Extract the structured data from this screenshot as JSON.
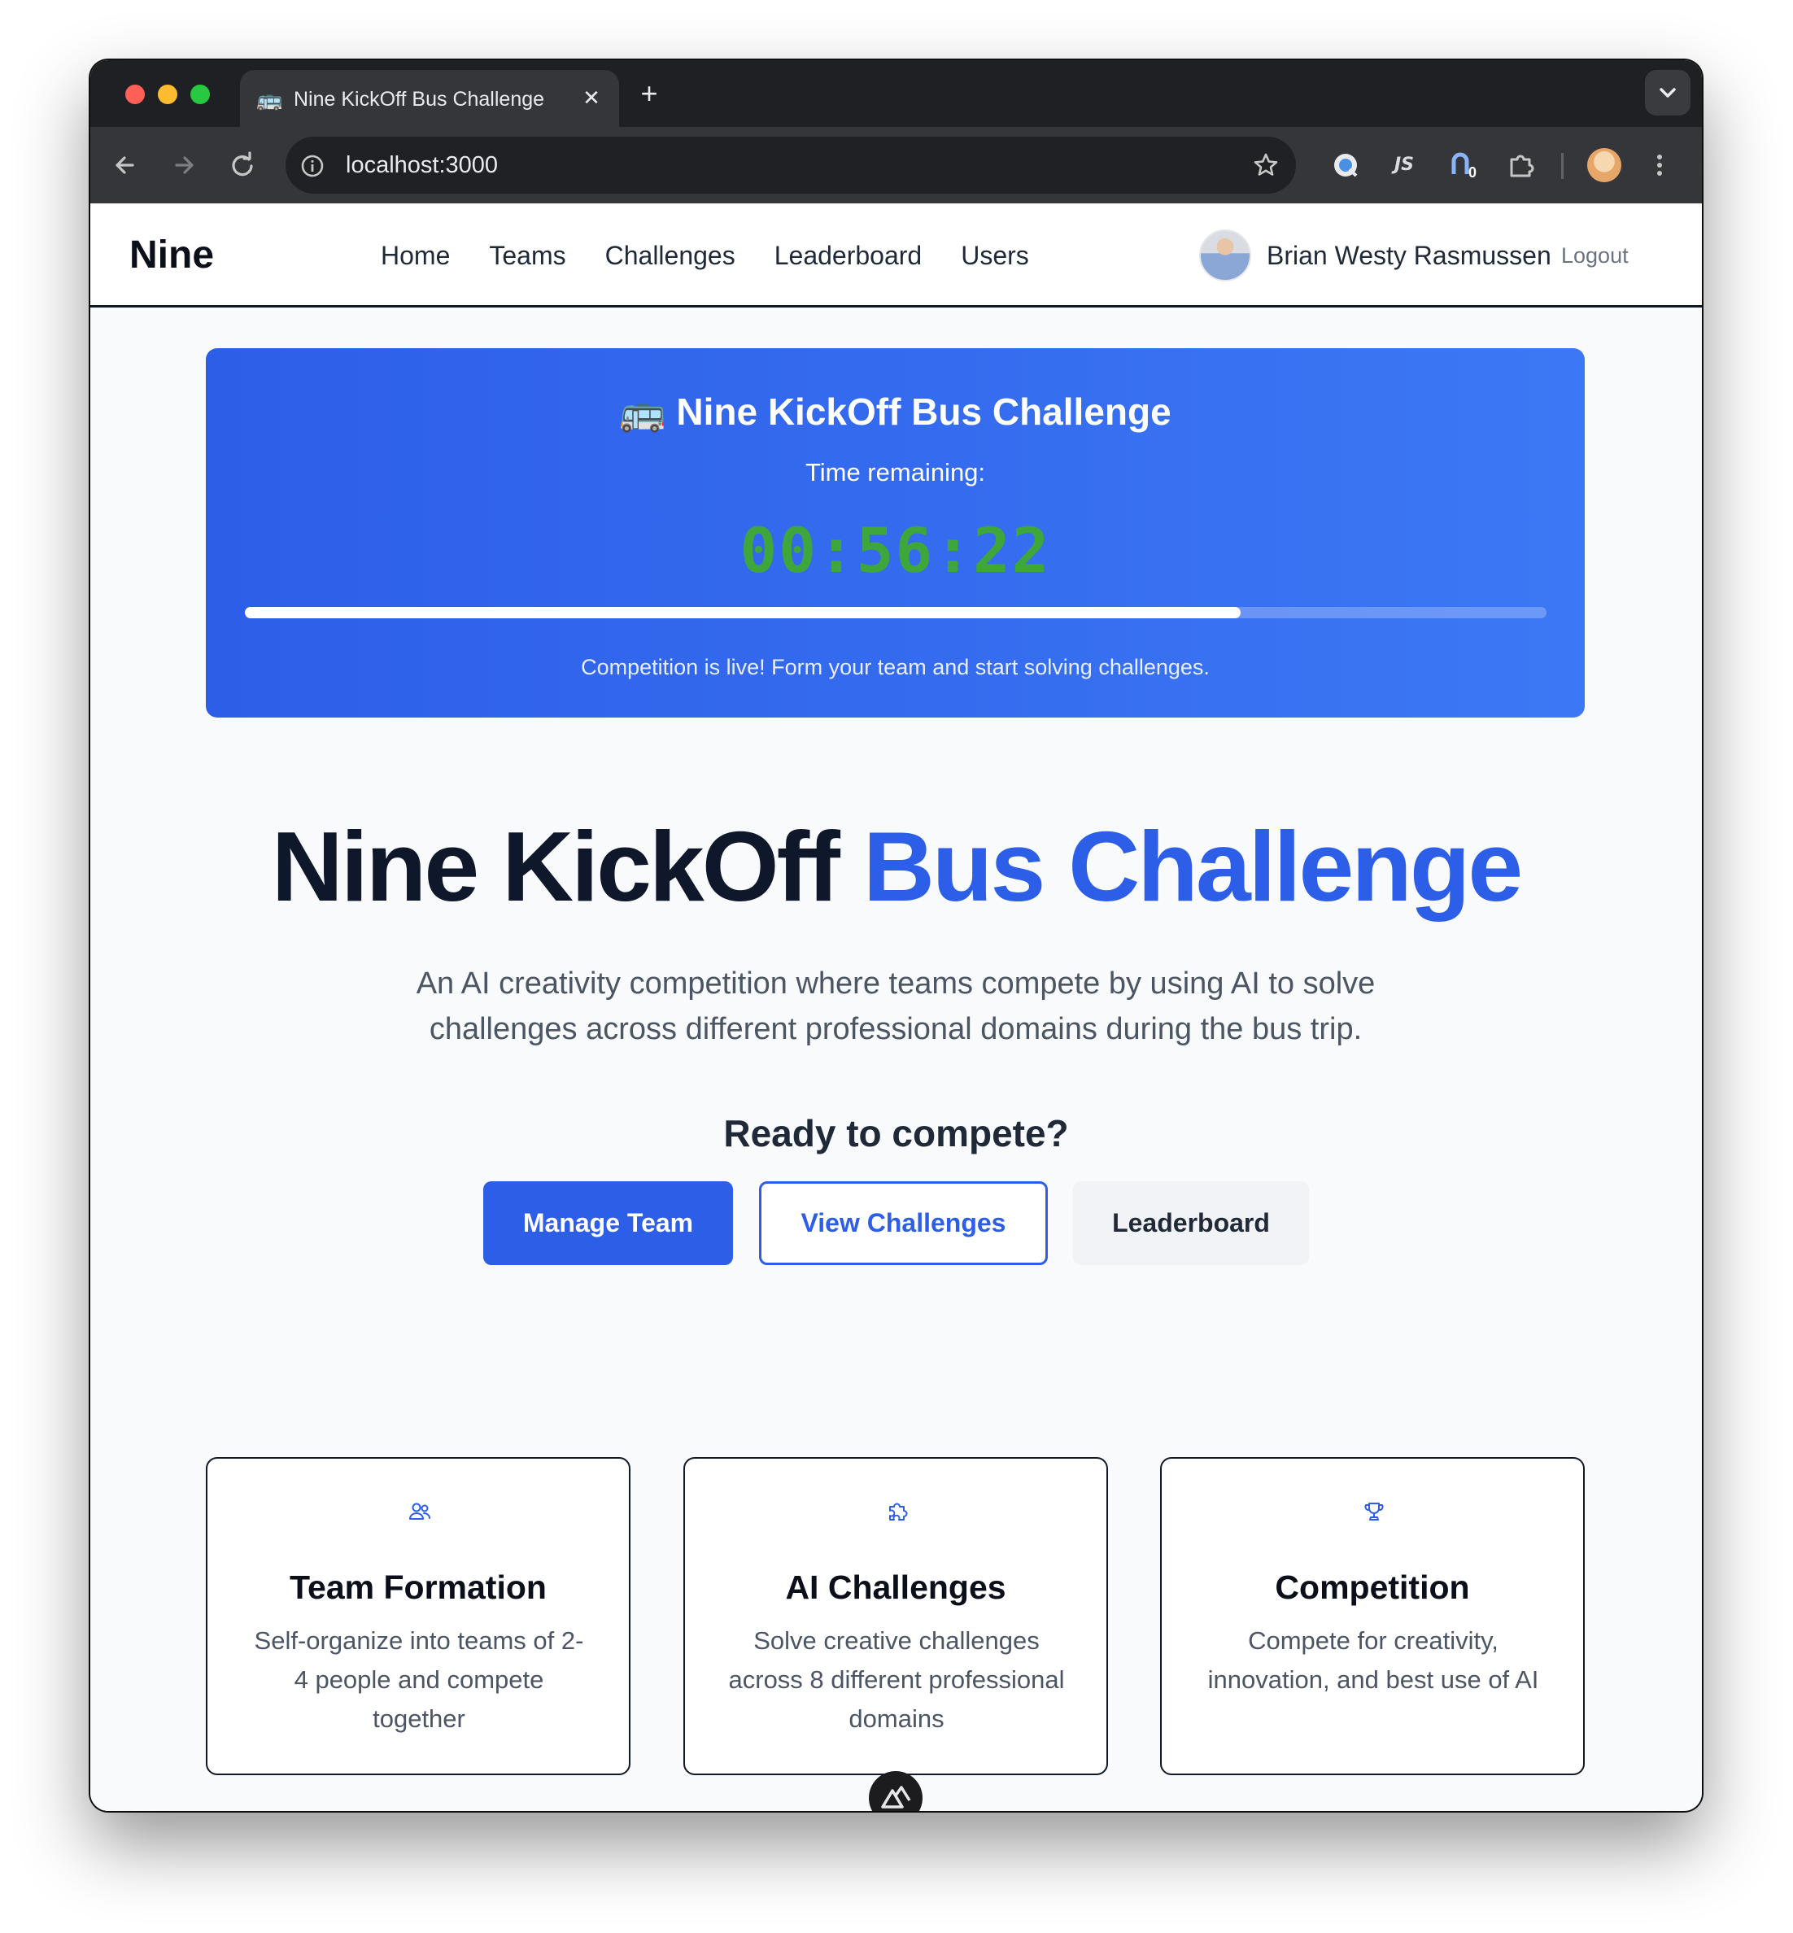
{
  "browser": {
    "tab_favicon": "🚌",
    "tab_title": "Nine KickOff Bus Challenge",
    "tab_close": "✕",
    "new_tab": "+",
    "url": "localhost:3000",
    "extensions": [
      {
        "name": "sparkle-extension-icon"
      },
      {
        "name": "js-extension-icon",
        "label": "JS"
      },
      {
        "name": "blue-extension-icon",
        "badge": "0"
      },
      {
        "name": "puzzle-extensions-icon"
      }
    ]
  },
  "header": {
    "brand": "Nine",
    "nav": [
      "Home",
      "Teams",
      "Challenges",
      "Leaderboard",
      "Users"
    ],
    "user_name": "Brian Westy Rasmussen",
    "logout": "Logout"
  },
  "countdown": {
    "icon": "🚌",
    "title": "Nine KickOff Bus Challenge",
    "subtitle": "Time remaining:",
    "timer": "00:56:22",
    "progress": 0.765,
    "note": "Competition is live! Form your team and start solving challenges."
  },
  "hero": {
    "title_main": "Nine KickOff ",
    "title_accent": "Bus Challenge",
    "lead": "An AI creativity competition where teams compete by using AI to solve challenges across different professional domains during the bus trip.",
    "cta_heading": "Ready to compete?",
    "buttons": {
      "manage_team": "Manage Team",
      "view_challenges": "View Challenges",
      "leaderboard": "Leaderboard"
    }
  },
  "features": [
    {
      "icon": "users-icon",
      "title": "Team Formation",
      "desc": "Self-organize into teams of 2-4 people and compete together"
    },
    {
      "icon": "puzzle-icon",
      "title": "AI Challenges",
      "desc": "Solve creative challenges across 8 different professional domains"
    },
    {
      "icon": "trophy-icon",
      "title": "Competition",
      "desc": "Compete for creativity, innovation, and best use of AI"
    }
  ],
  "colors": {
    "brand_blue": "#2d5ee8",
    "timer_green": "#3ea63b",
    "text_dark": "#0f172a",
    "text_muted": "#4b5563",
    "page_bg": "#f8fafc"
  }
}
